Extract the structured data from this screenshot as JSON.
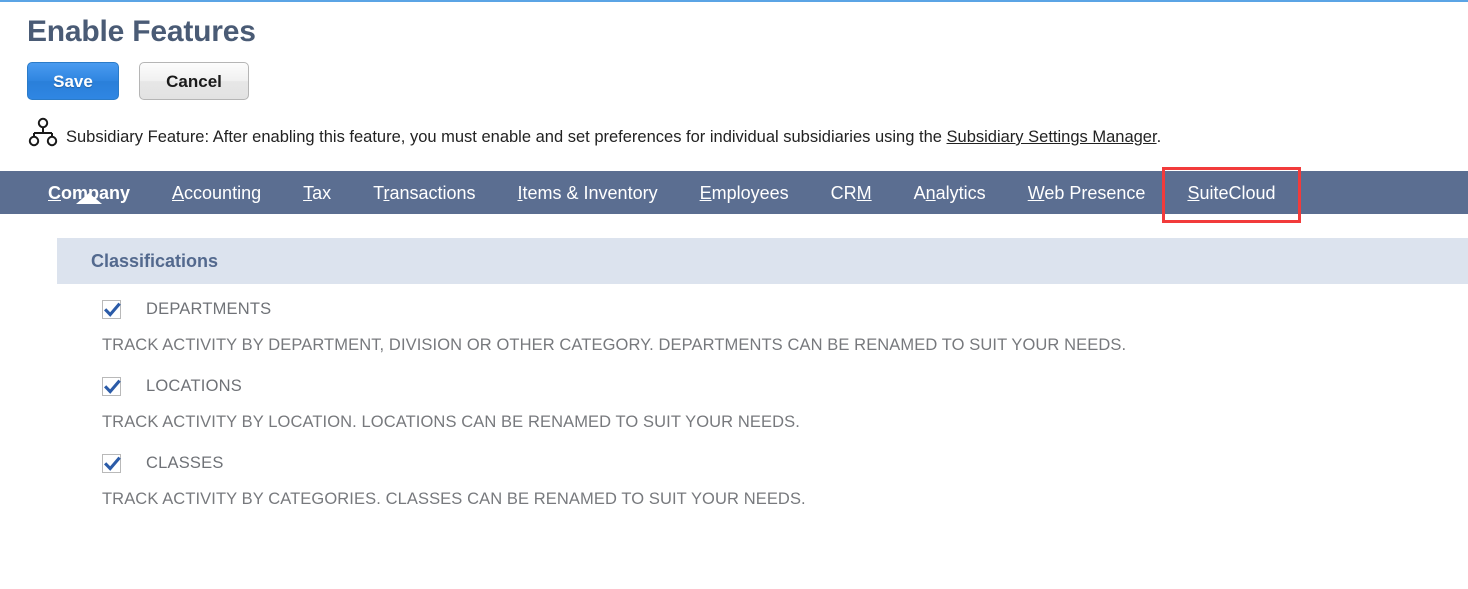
{
  "page": {
    "title": "Enable Features"
  },
  "toolbar": {
    "save_label": "Save",
    "cancel_label": "Cancel"
  },
  "note": {
    "icon": "hierarchy-icon",
    "text_before": "Subsidiary Feature: After enabling this feature, you must enable and set preferences for individual subsidiaries using the ",
    "link_label": "Subsidiary Settings Manager",
    "text_after": "."
  },
  "tabs": {
    "items": [
      {
        "label": "Company",
        "accesskey": "C",
        "active": true
      },
      {
        "label": "Accounting",
        "accesskey": "A",
        "active": false
      },
      {
        "label": "Tax",
        "accesskey": "T",
        "active": false
      },
      {
        "label": "Transactions",
        "accesskey": "r",
        "active": false
      },
      {
        "label": "Items & Inventory",
        "accesskey": "I",
        "active": false
      },
      {
        "label": "Employees",
        "accesskey": "E",
        "active": false
      },
      {
        "label": "CRM",
        "accesskey": "M",
        "active": false
      },
      {
        "label": "Analytics",
        "accesskey": "n",
        "active": false
      },
      {
        "label": "Web Presence",
        "accesskey": "W",
        "active": false
      },
      {
        "label": "SuiteCloud",
        "accesskey": "S",
        "active": false
      }
    ],
    "highlighted_tab": "SuiteCloud"
  },
  "section": {
    "header": "Classifications",
    "features": [
      {
        "label": "DEPARTMENTS",
        "checked": true,
        "description": "TRACK ACTIVITY BY DEPARTMENT, DIVISION OR OTHER CATEGORY. DEPARTMENTS CAN BE RENAMED TO SUIT YOUR NEEDS."
      },
      {
        "label": "LOCATIONS",
        "checked": true,
        "description": "TRACK ACTIVITY BY LOCATION. LOCATIONS CAN BE RENAMED TO SUIT YOUR NEEDS."
      },
      {
        "label": "CLASSES",
        "checked": true,
        "description": "TRACK ACTIVITY BY CATEGORIES. CLASSES CAN BE RENAMED TO SUIT YOUR NEEDS."
      }
    ]
  },
  "colors": {
    "top_rule": "#5ba4e5",
    "title": "#4a5b75",
    "primary_button": "#2f85e0",
    "tabbar": "#5b6e91",
    "section_header": "#dce3ee",
    "section_header_text": "#53698e",
    "annotation": "#f23b3b",
    "checkmark": "#2b5ba8"
  }
}
